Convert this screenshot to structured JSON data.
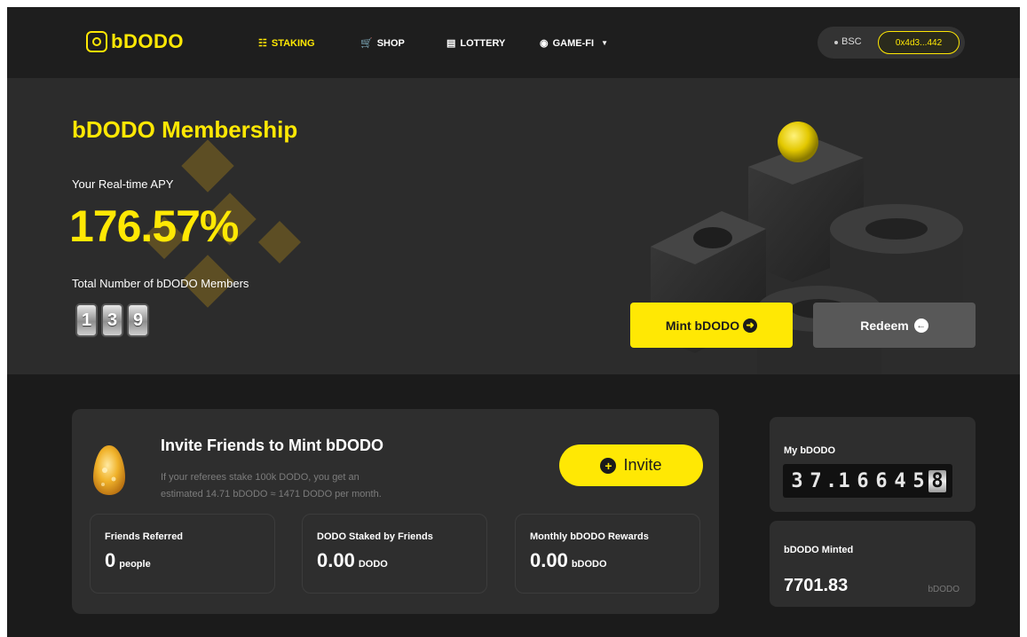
{
  "brand": {
    "name": "bDODO"
  },
  "nav": {
    "items": [
      {
        "label": "STAKING",
        "icon": "coins-icon",
        "active": true
      },
      {
        "label": "SHOP",
        "icon": "cart-icon",
        "active": false
      },
      {
        "label": "LOTTERY",
        "icon": "ticket-icon",
        "active": false
      },
      {
        "label": "GAME-FI",
        "icon": "gamepad-icon",
        "active": false
      }
    ],
    "network": "BSC",
    "address": "0x4d3...442"
  },
  "hero": {
    "title": "bDODO Membership",
    "apy_label": "Your Real-time APY",
    "apy_value": "176.57%",
    "members_label": "Total Number of bDODO Members",
    "members_digits": [
      "1",
      "3",
      "9"
    ],
    "mint_button": "Mint bDODO",
    "redeem_button": "Redeem"
  },
  "invite": {
    "title": "Invite Friends to Mint bDODO",
    "desc_line1": "If your referees stake 100k DODO, you get an",
    "desc_line2": "estimated 14.71 bDODO ≈ 1471 DODO per month.",
    "button": "Invite",
    "stats": [
      {
        "label": "Friends Referred",
        "value": "0",
        "unit": "people"
      },
      {
        "label": "DODO Staked by Friends",
        "value": "0.00",
        "unit": "DODO"
      },
      {
        "label": "Monthly bDODO Rewards",
        "value": "0.00",
        "unit": "bDODO"
      }
    ]
  },
  "my_bdodo": {
    "label": "My bDODO",
    "digits": [
      "3",
      "7",
      ".",
      "1",
      "6",
      "6",
      "4",
      "5",
      "8"
    ]
  },
  "minted": {
    "label": "bDODO Minted",
    "value": "7701.83",
    "unit": "bDODO"
  },
  "colors": {
    "accent": "#ffe804",
    "background": "#1b1b1b",
    "card": "#2e2e2e"
  }
}
